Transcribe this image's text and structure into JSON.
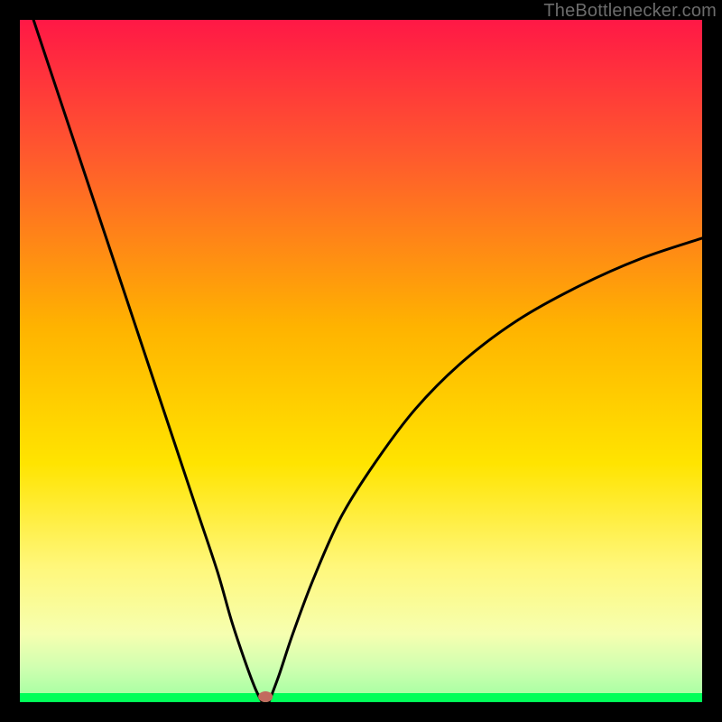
{
  "watermark": "TheBottlenecker.com",
  "colors": {
    "bg": "#000000",
    "curve": "#000000",
    "gradient_top": "#ff1846",
    "gradient_mid": "#ffd400",
    "gradient_green_band": "#00ff58",
    "marker": "#c26a5e"
  },
  "chart_data": {
    "type": "line",
    "title": "",
    "xlabel": "",
    "ylabel": "",
    "xlim": [
      0,
      100
    ],
    "ylim": [
      0,
      100
    ],
    "left_curve": {
      "x": [
        2,
        5,
        8,
        11,
        14,
        17,
        20,
        23,
        26,
        29,
        31,
        33,
        34.5,
        35.5
      ],
      "y": [
        100,
        91,
        82,
        73,
        64,
        55,
        46,
        37,
        28,
        19,
        12,
        6,
        2,
        0
      ]
    },
    "right_curve": {
      "x": [
        36.5,
        38,
        40,
        43,
        47,
        52,
        58,
        65,
        73,
        82,
        91,
        100
      ],
      "y": [
        0,
        4,
        10,
        18,
        27,
        35,
        43,
        50,
        56,
        61,
        65,
        68
      ]
    },
    "marker": {
      "x": 36,
      "y": 0
    }
  }
}
